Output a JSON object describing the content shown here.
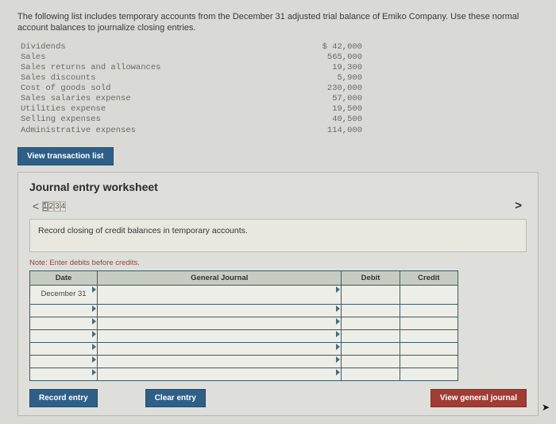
{
  "intro": "The following list includes temporary accounts from the December 31 adjusted trial balance of Emiko Company. Use these normal account balances to journalize closing entries.",
  "accounts": [
    {
      "label": "Dividends",
      "value": "$ 42,000"
    },
    {
      "label": "Sales",
      "value": "565,000"
    },
    {
      "label": "Sales returns and allowances",
      "value": "19,300"
    },
    {
      "label": "Sales discounts",
      "value": "5,900"
    },
    {
      "label": "Cost of goods sold",
      "value": "230,000"
    },
    {
      "label": "Sales salaries expense",
      "value": "57,000"
    },
    {
      "label": "Utilities expense",
      "value": "19,500"
    },
    {
      "label": "Selling expenses",
      "value": "40,500"
    },
    {
      "label": "Administrative expenses",
      "value": "114,000"
    }
  ],
  "buttons": {
    "view_transaction_list": "View transaction list",
    "record_entry": "Record entry",
    "clear_entry": "Clear entry",
    "view_general_journal": "View general journal"
  },
  "worksheet": {
    "title": "Journal entry worksheet",
    "steps": [
      "1",
      "2",
      "3",
      "4"
    ],
    "active_step": 0,
    "chevron_left": "<",
    "chevron_right": ">",
    "instruction": "Record closing of credit balances in temporary accounts.",
    "note": "Note: Enter debits before credits.",
    "headers": {
      "date": "Date",
      "gj": "General Journal",
      "debit": "Debit",
      "credit": "Credit"
    },
    "date_value": "December 31"
  }
}
